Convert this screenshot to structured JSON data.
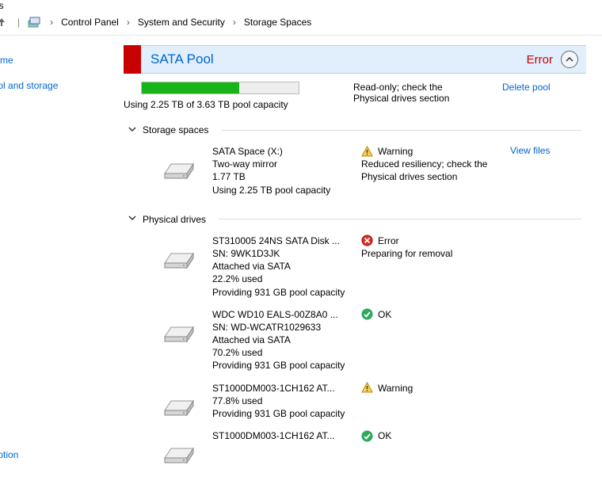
{
  "window": {
    "title_fragment": "ces"
  },
  "breadcrumbs": {
    "b1": "Control Panel",
    "b2": "System and Security",
    "b3": "Storage Spaces"
  },
  "sidebar": {
    "home": "el Home",
    "createpool": "w pool and storage",
    "bitlocker": "rive Encryption"
  },
  "pool": {
    "name": "SATA Pool",
    "status": "Error",
    "usage_text": "Using 2.25 TB of 3.63 TB pool capacity",
    "usage_percent": 62,
    "message": "Read-only; check the Physical drives section",
    "delete_link": "Delete pool"
  },
  "sections": {
    "spaces": "Storage spaces",
    "drives": "Physical drives"
  },
  "space": {
    "name": "SATA Space (X:)",
    "type": "Two-way mirror",
    "size": "1.77 TB",
    "usage": "Using 2.25 TB pool capacity",
    "status_label": "Warning",
    "status_msg": "Reduced resiliency; check the Physical drives section",
    "action": "View files"
  },
  "drives": [
    {
      "name": "ST310005 24NS SATA Disk ...",
      "sn": "SN: 9WK1D3JK",
      "conn": "Attached via SATA",
      "used": "22.2% used",
      "prov": "Providing 931 GB pool capacity",
      "status_type": "error",
      "status_label": "Error",
      "status_msg": "Preparing for removal"
    },
    {
      "name": "WDC WD10 EALS-00Z8A0 ...",
      "sn": "SN: WD-WCATR1029633",
      "conn": "Attached via SATA",
      "used": "70.2% used",
      "prov": "Providing 931 GB pool capacity",
      "status_type": "ok",
      "status_label": "OK",
      "status_msg": ""
    },
    {
      "name": "ST1000DM003-1CH162 AT...",
      "sn": "",
      "conn": "",
      "used": "77.8% used",
      "prov": "Providing 931 GB pool capacity",
      "status_type": "warning",
      "status_label": "Warning",
      "status_msg": ""
    },
    {
      "name": "ST1000DM003-1CH162 AT...",
      "sn": "",
      "conn": "",
      "used": "",
      "prov": "",
      "status_type": "ok",
      "status_label": "OK",
      "status_msg": ""
    }
  ]
}
